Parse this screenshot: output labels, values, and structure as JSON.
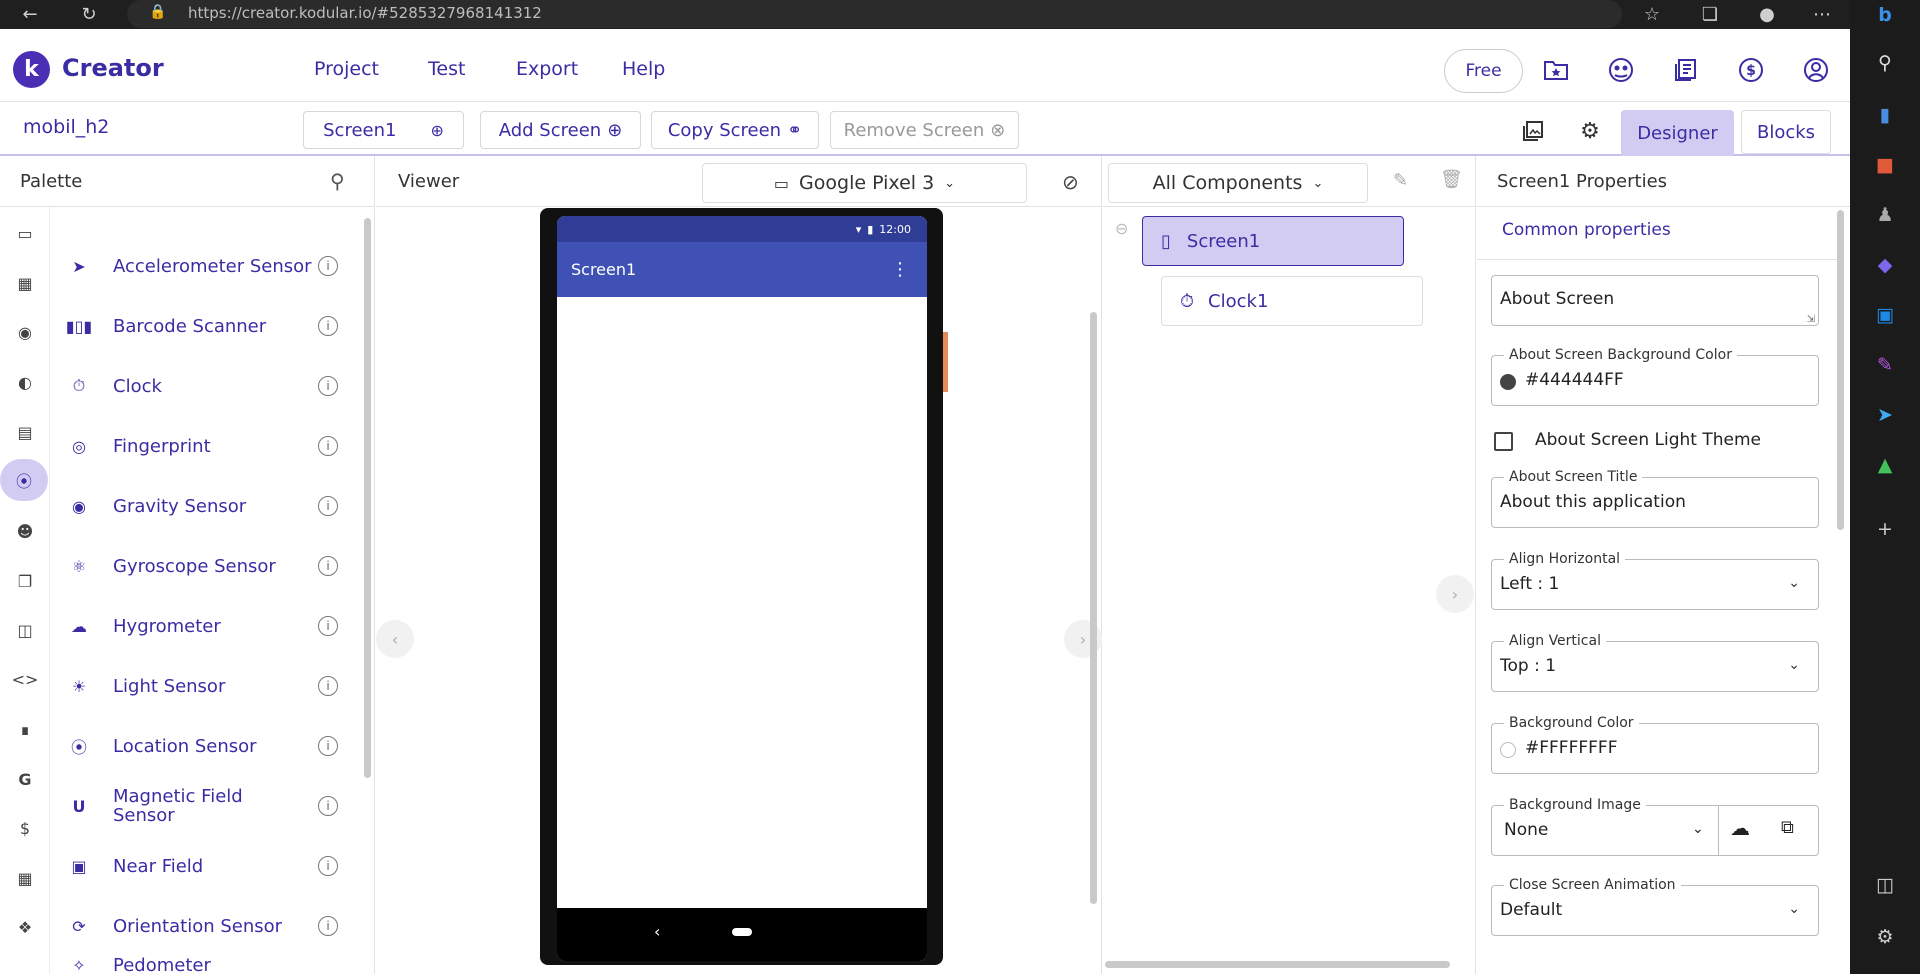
{
  "browser": {
    "url": "https://creator.kodular.io/#5285327968141312"
  },
  "app": {
    "brand": "Creator",
    "menu": [
      "Project",
      "Test",
      "Export",
      "Help"
    ],
    "free_label": "Free"
  },
  "toolbar": {
    "project_name": "mobil_h2",
    "screen_select": "Screen1",
    "add_screen": "Add Screen",
    "copy_screen": "Copy Screen",
    "remove_screen": "Remove Screen",
    "designer_tab": "Designer",
    "blocks_tab": "Blocks"
  },
  "palette": {
    "title": "Palette",
    "items": [
      {
        "label": "Accelerometer Sensor",
        "icon": "rocket-icon"
      },
      {
        "label": "Barcode Scanner",
        "icon": "barcode-icon"
      },
      {
        "label": "Clock",
        "icon": "timer-icon"
      },
      {
        "label": "Fingerprint",
        "icon": "fingerprint-icon"
      },
      {
        "label": "Gravity Sensor",
        "icon": "globe-icon"
      },
      {
        "label": "Gyroscope Sensor",
        "icon": "gyroscope-icon"
      },
      {
        "label": "Hygrometer",
        "icon": "cloud-rain-icon"
      },
      {
        "label": "Light Sensor",
        "icon": "lightbulb-icon"
      },
      {
        "label": "Location Sensor",
        "icon": "location-icon"
      },
      {
        "label": "Magnetic Field Sensor",
        "icon": "magnet-icon"
      },
      {
        "label": "Near Field",
        "icon": "nfc-icon"
      },
      {
        "label": "Orientation Sensor",
        "icon": "orientation-icon"
      },
      {
        "label": "Pedometer",
        "icon": "walk-icon"
      }
    ]
  },
  "viewer": {
    "title": "Viewer",
    "device": "Google Pixel 3",
    "phone_time": "12:00",
    "screen_title": "Screen1"
  },
  "components": {
    "filter": "All Components",
    "tree": [
      "Screen1",
      "Clock1"
    ]
  },
  "properties": {
    "title": "Screen1 Properties",
    "group": "Common properties",
    "about_screen": "About Screen",
    "about_bg_label": "About Screen Background Color",
    "about_bg_value": "#444444FF",
    "about_light_label": "About Screen Light Theme",
    "about_title_label": "About Screen Title",
    "about_title_value": "About this application",
    "align_h_label": "Align Horizontal",
    "align_h_value": "Left : 1",
    "align_v_label": "Align Vertical",
    "align_v_value": "Top : 1",
    "bg_color_label": "Background Color",
    "bg_color_value": "#FFFFFFFF",
    "bg_image_label": "Background Image",
    "bg_image_value": "None",
    "close_anim_label": "Close Screen Animation",
    "close_anim_value": "Default"
  },
  "colors": {
    "accent": "#3a2da4",
    "selected_bg": "#d3ccf2",
    "phone_appbar": "#3f51b5"
  }
}
